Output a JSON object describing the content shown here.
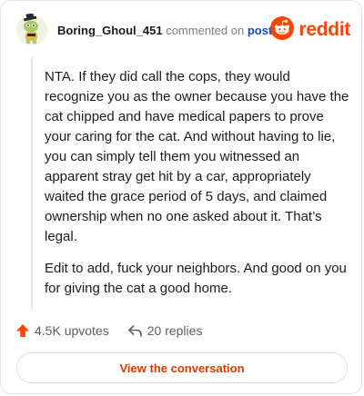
{
  "header": {
    "username": "Boring_Ghoul_451",
    "action_text": "commented on",
    "post_link_text": "post",
    "avatar_icon": "snoo-avatar-icon",
    "brand_icon": "reddit-logo-icon",
    "brand_text": "reddit"
  },
  "comment": {
    "paragraphs": [
      "NTA. If they did call the cops, they would recognize you as the owner because you have the cat chipped and have medical papers to prove your caring for the cat. And without having to lie, you can simply tell them you witnessed an apparent stray get hit by a car, appropriately waited the grace period of 5 days, and claimed ownership when no one asked about it. That’s legal.",
      "Edit to add, fuck your neighbors. And good on you for giving the cat a good home."
    ]
  },
  "footer": {
    "upvotes_icon": "upvote-arrow-icon",
    "upvotes_text": "4.5K upvotes",
    "replies_icon": "reply-arrow-icon",
    "replies_text": "20 replies"
  },
  "cta": {
    "label": "View the conversation"
  },
  "colors": {
    "brand": "#ff4500",
    "link": "#1a4cb0",
    "cta_text": "#d93a00",
    "muted": "#7c7c7c"
  }
}
